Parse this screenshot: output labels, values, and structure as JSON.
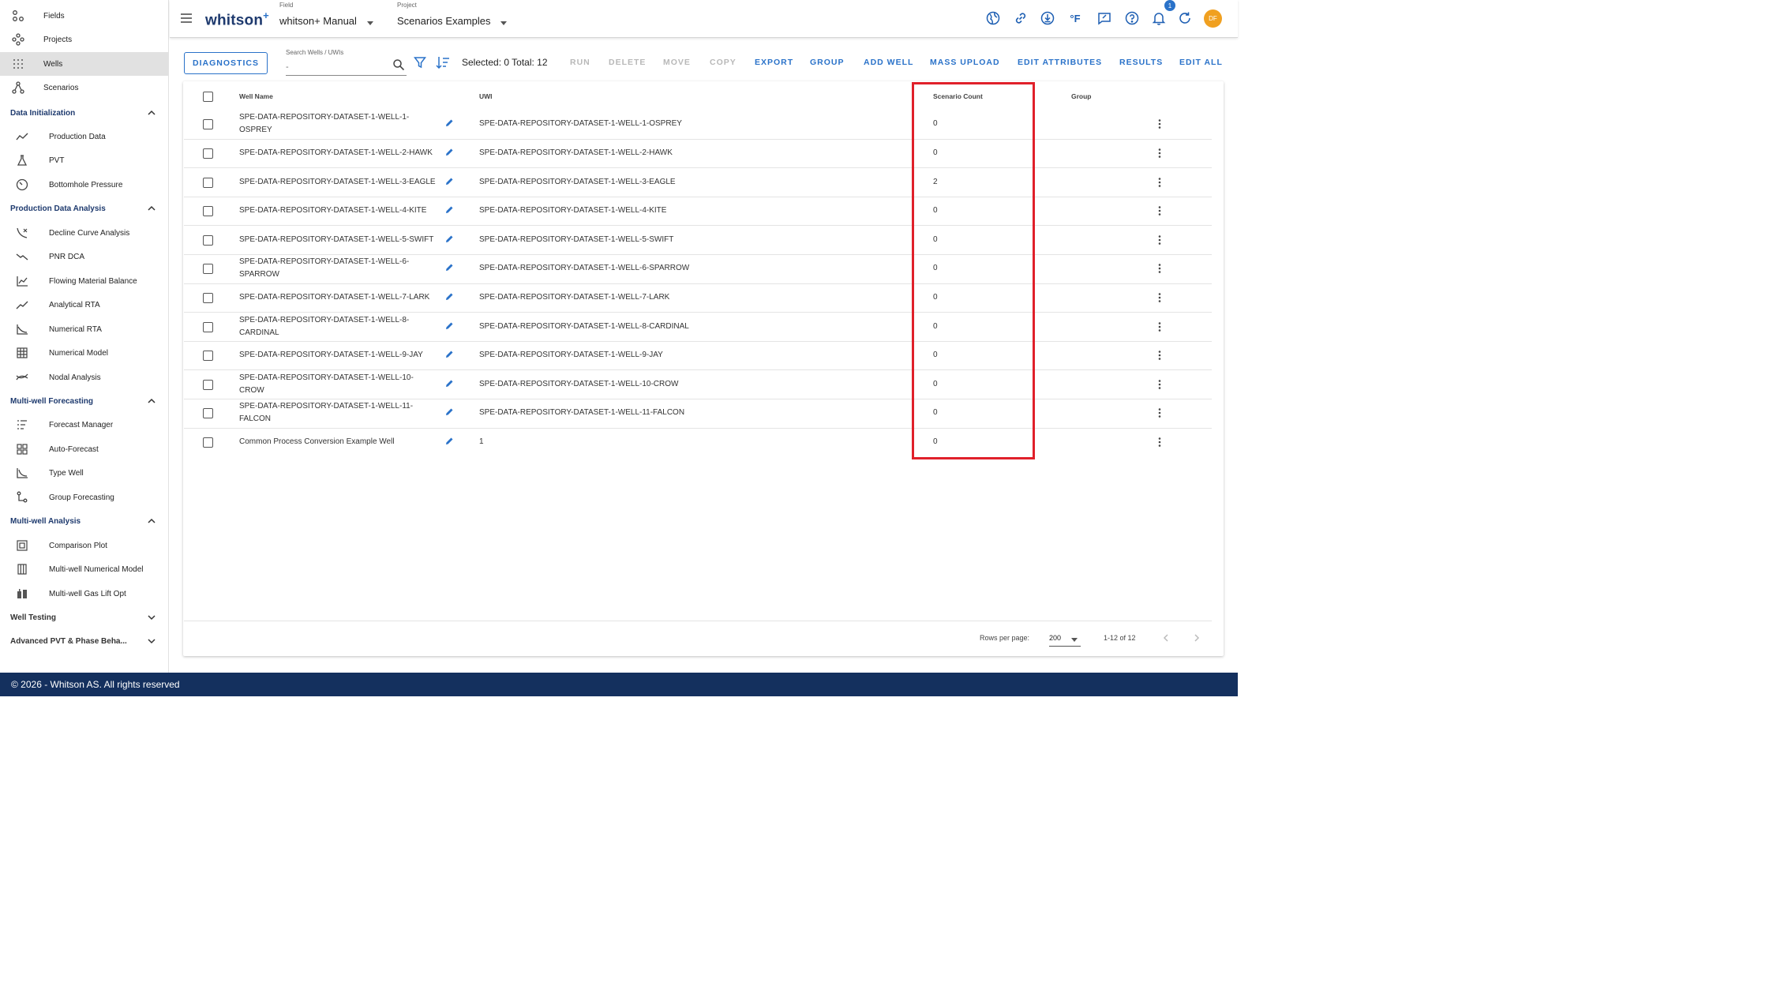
{
  "sidebar": {
    "top_items": [
      {
        "label": "Fields",
        "icon": "fields-icon"
      },
      {
        "label": "Projects",
        "icon": "projects-icon"
      },
      {
        "label": "Wells",
        "icon": "wells-icon",
        "active": true
      },
      {
        "label": "Scenarios",
        "icon": "scenarios-icon"
      }
    ],
    "sections": [
      {
        "title": "Data Initialization",
        "expanded": true,
        "items": [
          {
            "label": "Production Data"
          },
          {
            "label": "PVT"
          },
          {
            "label": "Bottomhole Pressure"
          }
        ]
      },
      {
        "title": "Production Data Analysis",
        "expanded": true,
        "items": [
          {
            "label": "Decline Curve Analysis"
          },
          {
            "label": "PNR DCA"
          },
          {
            "label": "Flowing Material Balance"
          },
          {
            "label": "Analytical RTA"
          },
          {
            "label": "Numerical RTA"
          },
          {
            "label": "Numerical Model"
          },
          {
            "label": "Nodal Analysis"
          }
        ]
      },
      {
        "title": "Multi-well Forecasting",
        "expanded": true,
        "items": [
          {
            "label": "Forecast Manager"
          },
          {
            "label": "Auto-Forecast"
          },
          {
            "label": "Type Well"
          },
          {
            "label": "Group Forecasting"
          }
        ]
      },
      {
        "title": "Multi-well Analysis",
        "expanded": true,
        "items": [
          {
            "label": "Comparison Plot"
          },
          {
            "label": "Multi-well Numerical Model"
          },
          {
            "label": "Multi-well Gas Lift Opt"
          }
        ]
      },
      {
        "title": "Well Testing",
        "expanded": false,
        "items": []
      },
      {
        "title": "Advanced PVT & Phase Beha...",
        "expanded": false,
        "items": []
      }
    ]
  },
  "header": {
    "logo": "whitson",
    "logo_sup": "+",
    "field_caption": "Field",
    "field_value": "whitson+ Manual",
    "project_caption": "Project",
    "project_value": "Scenarios Examples",
    "notification_count": "1",
    "avatar_initials": "DF",
    "temp_unit": "°F"
  },
  "toolbar": {
    "diagnostics": "DIAGNOSTICS",
    "search_caption": "Search Wells / UWIs",
    "search_placeholder": "-",
    "selection_text": "Selected: 0 Total: 12",
    "buttons": [
      {
        "label": "RUN",
        "enabled": false
      },
      {
        "label": "DELETE",
        "enabled": false
      },
      {
        "label": "MOVE",
        "enabled": false
      },
      {
        "label": "COPY",
        "enabled": false
      },
      {
        "label": "EXPORT",
        "enabled": true
      },
      {
        "label": "GROUP",
        "enabled": true
      },
      {
        "label": "ADD WELL",
        "enabled": true
      },
      {
        "label": "MASS UPLOAD",
        "enabled": true
      },
      {
        "label": "EDIT ATTRIBUTES",
        "enabled": true
      },
      {
        "label": "RESULTS",
        "enabled": true
      },
      {
        "label": "EDIT ALL",
        "enabled": true
      }
    ]
  },
  "table": {
    "columns": {
      "well_name": "Well Name",
      "uwi": "UWI",
      "scenario_count": "Scenario Count",
      "group": "Group"
    },
    "rows": [
      {
        "well_name": "SPE-DATA-REPOSITORY-DATASET-1-WELL-1-OSPREY",
        "uwi": "SPE-DATA-REPOSITORY-DATASET-1-WELL-1-OSPREY",
        "scenario_count": "0",
        "group": ""
      },
      {
        "well_name": "SPE-DATA-REPOSITORY-DATASET-1-WELL-2-HAWK",
        "uwi": "SPE-DATA-REPOSITORY-DATASET-1-WELL-2-HAWK",
        "scenario_count": "0",
        "group": ""
      },
      {
        "well_name": "SPE-DATA-REPOSITORY-DATASET-1-WELL-3-EAGLE",
        "uwi": "SPE-DATA-REPOSITORY-DATASET-1-WELL-3-EAGLE",
        "scenario_count": "2",
        "group": ""
      },
      {
        "well_name": "SPE-DATA-REPOSITORY-DATASET-1-WELL-4-KITE",
        "uwi": "SPE-DATA-REPOSITORY-DATASET-1-WELL-4-KITE",
        "scenario_count": "0",
        "group": ""
      },
      {
        "well_name": "SPE-DATA-REPOSITORY-DATASET-1-WELL-5-SWIFT",
        "uwi": "SPE-DATA-REPOSITORY-DATASET-1-WELL-5-SWIFT",
        "scenario_count": "0",
        "group": ""
      },
      {
        "well_name": "SPE-DATA-REPOSITORY-DATASET-1-WELL-6-SPARROW",
        "uwi": "SPE-DATA-REPOSITORY-DATASET-1-WELL-6-SPARROW",
        "scenario_count": "0",
        "group": ""
      },
      {
        "well_name": "SPE-DATA-REPOSITORY-DATASET-1-WELL-7-LARK",
        "uwi": "SPE-DATA-REPOSITORY-DATASET-1-WELL-7-LARK",
        "scenario_count": "0",
        "group": ""
      },
      {
        "well_name": "SPE-DATA-REPOSITORY-DATASET-1-WELL-8-CARDINAL",
        "uwi": "SPE-DATA-REPOSITORY-DATASET-1-WELL-8-CARDINAL",
        "scenario_count": "0",
        "group": ""
      },
      {
        "well_name": "SPE-DATA-REPOSITORY-DATASET-1-WELL-9-JAY",
        "uwi": "SPE-DATA-REPOSITORY-DATASET-1-WELL-9-JAY",
        "scenario_count": "0",
        "group": ""
      },
      {
        "well_name": "SPE-DATA-REPOSITORY-DATASET-1-WELL-10-CROW",
        "uwi": "SPE-DATA-REPOSITORY-DATASET-1-WELL-10-CROW",
        "scenario_count": "0",
        "group": ""
      },
      {
        "well_name": "SPE-DATA-REPOSITORY-DATASET-1-WELL-11-FALCON",
        "uwi": "SPE-DATA-REPOSITORY-DATASET-1-WELL-11-FALCON",
        "scenario_count": "0",
        "group": ""
      },
      {
        "well_name": "Common Process Conversion Example Well",
        "uwi": "1",
        "scenario_count": "0",
        "group": ""
      }
    ],
    "rows_per_page_label": "Rows per page:",
    "rows_per_page": "200",
    "range_label": "1-12 of 12"
  },
  "footer": {
    "copyright": "© 2026 - Whitson AS. All rights reserved"
  },
  "colors": {
    "brand_navy": "#14305e",
    "accent_blue": "#2a72c9",
    "highlight_red": "#e0202a",
    "avatar_orange": "#f0a020"
  }
}
